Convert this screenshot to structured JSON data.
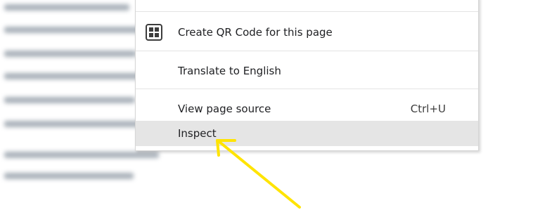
{
  "context_menu": {
    "items": [
      {
        "label": "Create QR Code for this page",
        "icon": "qr-code-icon"
      },
      {
        "label": "Translate to English"
      },
      {
        "label": "View page source",
        "shortcut": "Ctrl+U"
      },
      {
        "label": "Inspect",
        "highlighted": true
      }
    ]
  },
  "annotation": {
    "arrow_color": "#ffe400",
    "target": "Inspect"
  },
  "colors": {
    "highlight": "#e5e5e5",
    "text": "#202124"
  }
}
